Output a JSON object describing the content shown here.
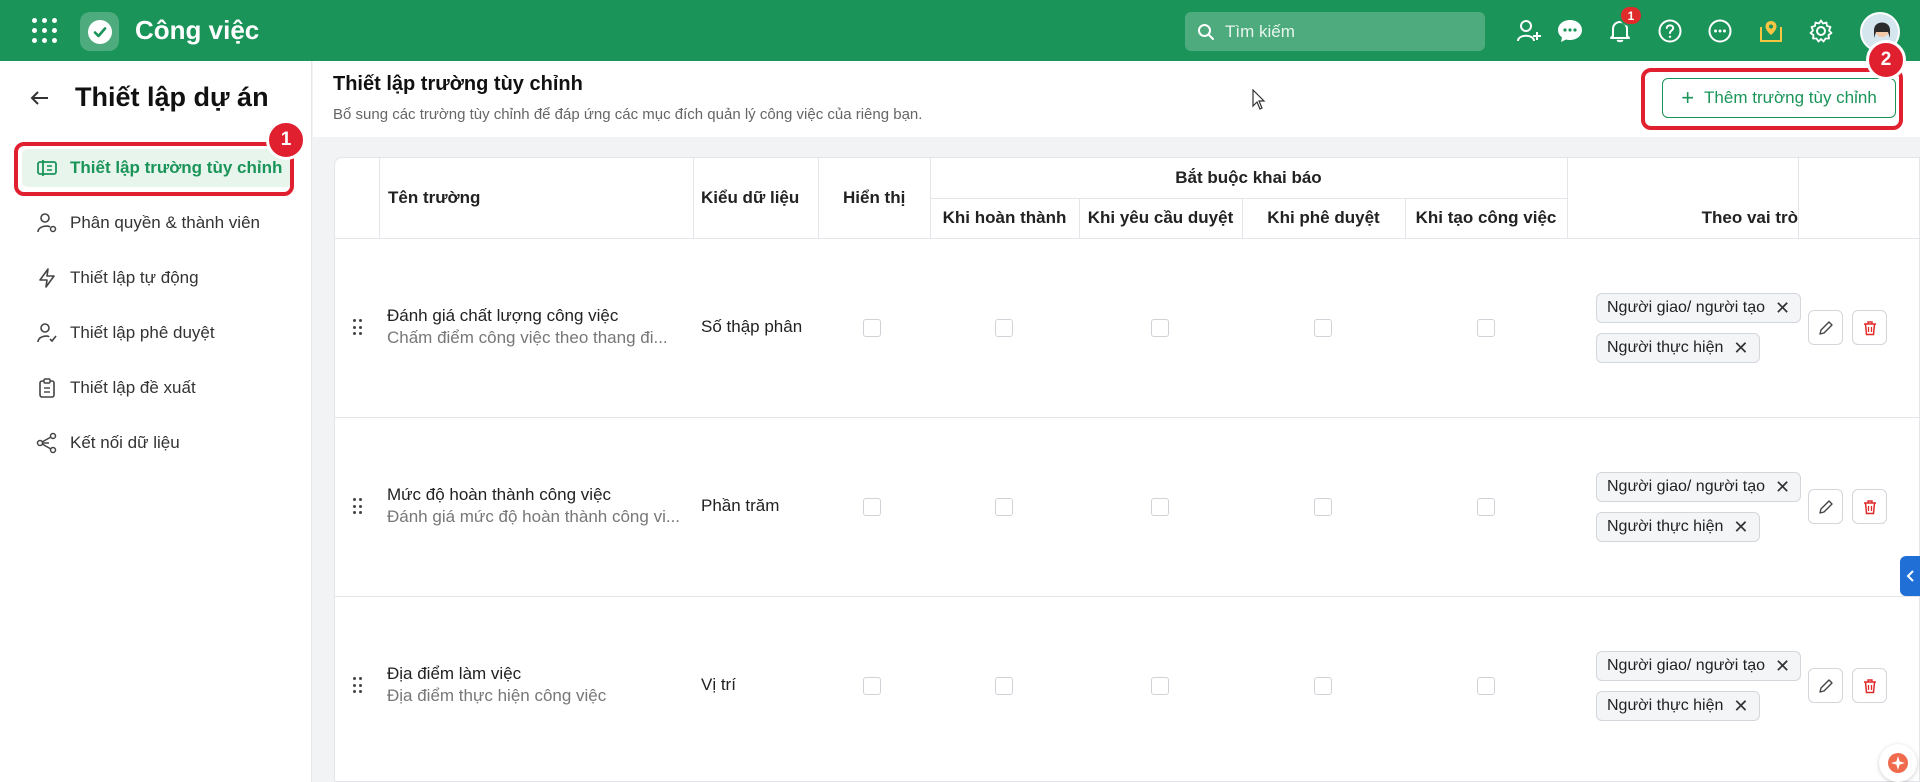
{
  "topbar": {
    "app_title": "Công việc",
    "search_placeholder": "Tìm kiếm",
    "notification_count": "1",
    "icons": [
      "apps-grid-icon",
      "app-logo-check-icon",
      "search-icon",
      "add-user-icon",
      "chat-icon",
      "bell-icon",
      "help-icon",
      "more-icon",
      "location-badge-icon",
      "gear-icon"
    ]
  },
  "sidebar": {
    "title": "Thiết lập dự án",
    "items": [
      {
        "label": "Thiết lập trường tùy chỉnh",
        "icon": "custom-field-icon",
        "active": true
      },
      {
        "label": "Phân quyền & thành viên",
        "icon": "user-settings-icon"
      },
      {
        "label": "Thiết lập tự động",
        "icon": "lightning-icon"
      },
      {
        "label": "Thiết lập phê duyệt",
        "icon": "user-check-icon"
      },
      {
        "label": "Thiết lập đề xuất",
        "icon": "clipboard-icon"
      },
      {
        "label": "Kết nối dữ liệu",
        "icon": "share-nodes-icon"
      }
    ]
  },
  "markers": {
    "one": "1",
    "two": "2"
  },
  "header": {
    "title": "Thiết lập trường tùy chỉnh",
    "subtitle": "Bổ sung các trường tùy chỉnh để đáp ứng các mục đích quản lý công việc của riêng bạn.",
    "add_button": "Thêm trường tùy chỉnh"
  },
  "table": {
    "columns": {
      "name": "Tên trường",
      "type": "Kiểu dữ liệu",
      "visible": "Hiển thị",
      "required_group": "Bắt buộc khai báo",
      "on_complete": "Khi hoàn thành",
      "on_request": "Khi yêu cầu duyệt",
      "on_approve": "Khi phê duyệt",
      "on_create": "Khi tạo công việc",
      "by_role": "Theo vai trò"
    },
    "rows": [
      {
        "name": "Đánh giá chất lượng công việc",
        "desc": "Chấm điểm công việc theo thang đi...",
        "type": "Số thập phân",
        "roles": [
          "Người giao/ người tạo",
          "Người thực hiện"
        ]
      },
      {
        "name": "Mức độ hoàn thành công việc",
        "desc": "Đánh giá mức độ hoàn thành công vi...",
        "type": "Phần trăm",
        "roles": [
          "Người giao/ người tạo",
          "Người thực hiện"
        ]
      },
      {
        "name": "Địa điểm làm việc",
        "desc": "Địa điểm thực hiện công việc",
        "type": "Vị trí",
        "roles": [
          "Người giao/ người tạo",
          "Người thực hiện"
        ]
      }
    ]
  },
  "colors": {
    "brand": "#1b9459",
    "highlight": "#e0202e",
    "danger": "#e02b2b"
  }
}
